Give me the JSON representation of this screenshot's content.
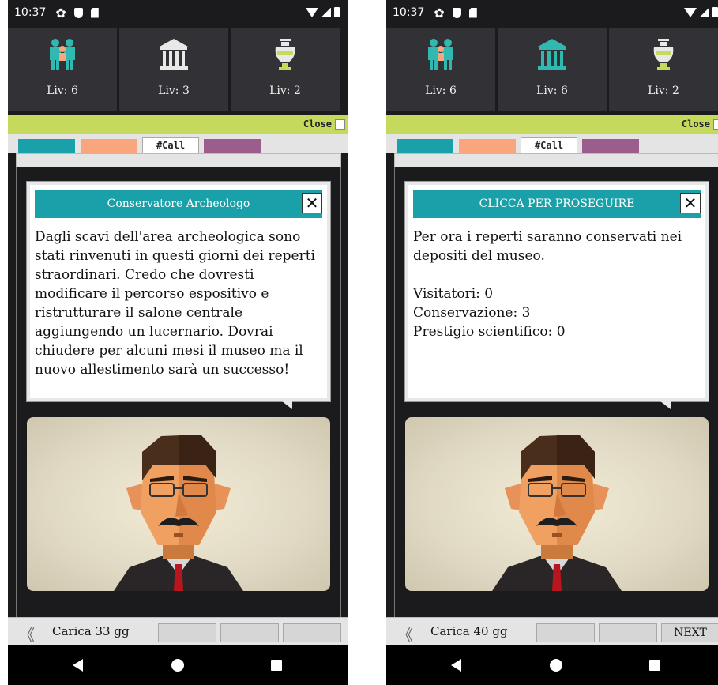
{
  "screens": [
    {
      "status": {
        "time": "10:37"
      },
      "stats": [
        {
          "icon": "visitors-icon",
          "level": "Liv: 6"
        },
        {
          "icon": "museum-icon",
          "level": "Liv: 3"
        },
        {
          "icon": "vase-icon",
          "level": "Liv: 2"
        }
      ],
      "close_label": "Close",
      "tab_call": "#Call",
      "dialog": {
        "title": "Conservatore Archeologo",
        "close_glyph": "✕",
        "body": "Dagli scavi dell'area archeologica sono stati rinvenuti in questi giorni dei reperti straordinari. Credo che dovresti modificare il percorso espositivo e ristrutturare il salone centrale aggiungendo un lucernario. Dovrai chiudere per alcuni mesi il museo ma il nuovo allestimento sarà un successo!"
      },
      "bottom": {
        "back_glyph": "《",
        "days": "Carica 33 gg",
        "buttons": [
          "",
          "",
          ""
        ]
      }
    },
    {
      "status": {
        "time": "10:37"
      },
      "stats": [
        {
          "icon": "visitors-icon",
          "level": "Liv: 6"
        },
        {
          "icon": "museum-icon",
          "level": "Liv: 6"
        },
        {
          "icon": "vase-icon",
          "level": "Liv: 2"
        }
      ],
      "close_label": "Close",
      "tab_call": "#Call",
      "dialog": {
        "title": "CLICCA PER PROSEGUIRE",
        "close_glyph": "✕",
        "body": "Per ora i reperti saranno conservati nei depositi del museo.\n\nVisitatori: 0\nConservazione: 3\nPrestigio scientifico: 0"
      },
      "bottom": {
        "back_glyph": "《",
        "days": "Carica 40 gg",
        "buttons": [
          "",
          "",
          "NEXT"
        ]
      }
    }
  ],
  "colors": {
    "teal": "#1aa0a8",
    "salmon": "#f9a57d",
    "purple": "#9a5d8c",
    "lime": "#c5da5c",
    "tile": "#323236"
  }
}
